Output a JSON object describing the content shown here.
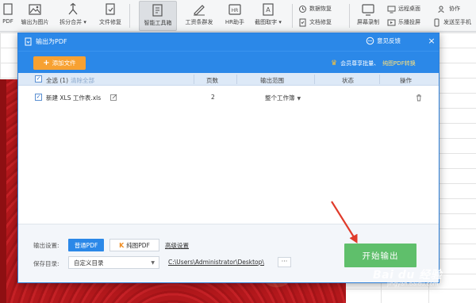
{
  "ribbon": {
    "buttons": [
      {
        "label": "PDF",
        "icon": "pdf-icon"
      },
      {
        "label": "输出为图片",
        "icon": "image-export-icon"
      },
      {
        "label": "拆分合并 ▾",
        "icon": "split-merge-icon"
      },
      {
        "label": "文件修复",
        "icon": "file-repair-icon"
      },
      {
        "label": "智能工具箱",
        "icon": "smart-toolbox-icon"
      },
      {
        "label": "工资条群发",
        "icon": "payslip-icon"
      },
      {
        "label": "HR助手",
        "icon": "hr-icon"
      },
      {
        "label": "截图取字 ▾",
        "icon": "ocr-icon"
      }
    ],
    "small": [
      {
        "label": "数据恢复",
        "icon": "data-recovery-icon"
      },
      {
        "label": "文档修复",
        "icon": "doc-repair-icon"
      },
      {
        "label": "屏幕录制",
        "icon": "screen-record-icon"
      },
      {
        "label": "远程桌面",
        "icon": "remote-desktop-icon"
      },
      {
        "label": "乐播投屏",
        "icon": "cast-icon"
      },
      {
        "label": "协作",
        "icon": "collab-icon"
      },
      {
        "label": "发送至手机",
        "icon": "phone-icon"
      }
    ]
  },
  "dialog": {
    "title": "输出为PDF",
    "feedback": "意见反馈",
    "close": "×",
    "add_files": "添加文件",
    "vip_text": "会员尊享批量、",
    "vip_link": "纯图PDF转换",
    "table": {
      "select_all": "全选 (1)",
      "delete_all": "清除全部",
      "headers": {
        "pages": "页数",
        "range": "输出范围",
        "status": "状态",
        "action": "操作"
      },
      "rows": [
        {
          "name": "新建 XLS 工作表.xls",
          "pages": "2",
          "range": "整个工作簿",
          "status": ""
        }
      ]
    },
    "footer": {
      "output_settings_label": "输出设置:",
      "format_normal": "普通PDF",
      "format_pure": "纯图PDF",
      "advanced": "高级设置",
      "save_dir_label": "保存目录:",
      "save_dir_value": "自定义目录",
      "path": "C:\\Users\\Administrator\\Desktop\\",
      "browse": "···",
      "start": "开始输出"
    }
  },
  "watermark": {
    "text": "Bai du 经验",
    "sub": "jingyan.baidu.com"
  },
  "colors": {
    "accent": "#2b88e8",
    "add_button": "#f7a132",
    "start_button": "#5fbf6b",
    "arrow": "#e03b2b"
  }
}
